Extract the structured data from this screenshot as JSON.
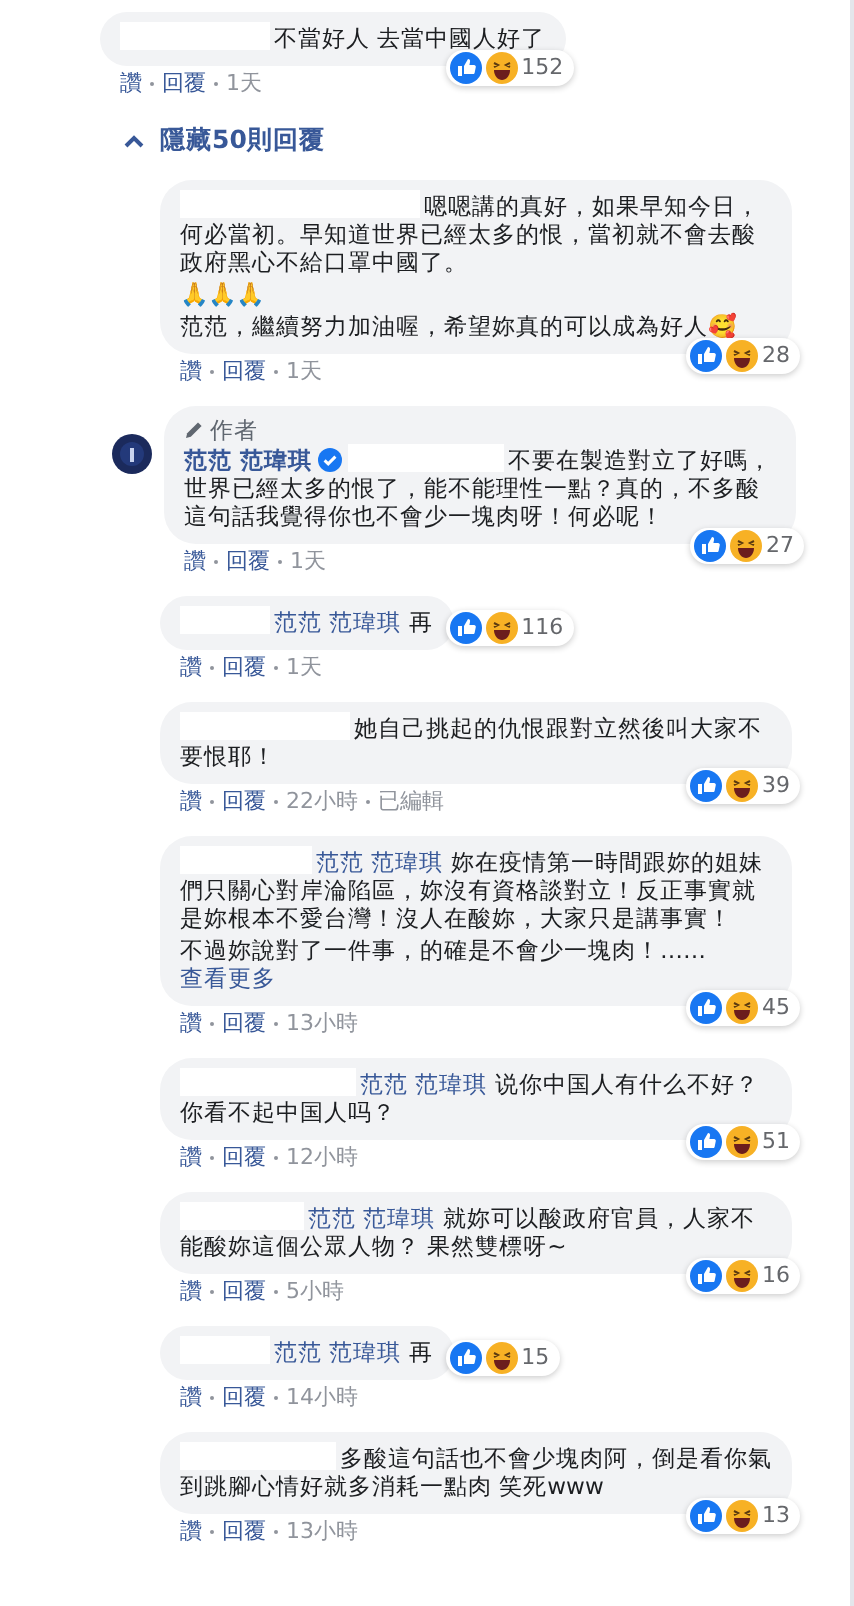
{
  "top_comment": {
    "paragraphs": [
      "不當好人 去當中國人好了"
    ],
    "reaction_count": "152",
    "actions": [
      "讚",
      "回覆",
      "1天"
    ]
  },
  "replies_toggle": {
    "label": "隱藏50則回覆"
  },
  "replies": [
    {
      "paragraphs": [
        "嗯嗯講的真好，如果早知今日，何必當初。早知道世界已經太多的恨，當初就不會去酸政府黑心不給口罩中國了。",
        "🙏🙏🙏",
        "范范，繼續努力加油喔，希望妳真的可以成為好人🥰"
      ],
      "reaction_count": "28",
      "actions": [
        "讚",
        "回覆",
        "1天"
      ]
    },
    {
      "author_badge": "作者",
      "author": "范范 范瑋琪",
      "verified": true,
      "paragraphs": [
        "不要在製造對立了好嗎，世界已經太多的恨了，能不能理性一點？真的，不多酸這句話我覺得你也不會少一塊肉呀！何必呢！"
      ],
      "reaction_count": "27",
      "actions": [
        "讚",
        "回覆",
        "1天"
      ]
    },
    {
      "mention": "范范 范瑋琪",
      "paragraphs": [
        "再"
      ],
      "reaction_count": "116",
      "actions": [
        "讚",
        "回覆",
        "1天"
      ]
    },
    {
      "paragraphs": [
        "她自己挑起的仇恨跟對立然後叫大家不要恨耶！"
      ],
      "reaction_count": "39",
      "actions": [
        "讚",
        "回覆",
        "22小時",
        "已編輯"
      ]
    },
    {
      "mention": "范范 范瑋琪",
      "paragraphs": [
        "妳在疫情第一時間跟妳的姐妹們只關心對岸淪陷區，妳沒有資格談對立！反正事實就是妳根本不愛台灣！沒人在酸妳，大家只是講事實！",
        "不過妳說對了一件事，的確是不會少一塊肉！……"
      ],
      "see_more": "查看更多",
      "reaction_count": "45",
      "actions": [
        "讚",
        "回覆",
        "13小時"
      ]
    },
    {
      "mention": "范范 范瑋琪",
      "paragraphs": [
        "说你中国人有什么不好？你看不起中国人吗？"
      ],
      "reaction_count": "51",
      "actions": [
        "讚",
        "回覆",
        "12小時"
      ]
    },
    {
      "mention": "范范 范瑋琪",
      "paragraphs": [
        "就妳可以酸政府官員，人家不能酸妳這個公眾人物？ 果然雙標呀~"
      ],
      "reaction_count": "16",
      "actions": [
        "讚",
        "回覆",
        "5小時"
      ]
    },
    {
      "mention": "范范 范瑋琪",
      "paragraphs": [
        "再"
      ],
      "reaction_count": "15",
      "actions": [
        "讚",
        "回覆",
        "14小時"
      ]
    },
    {
      "paragraphs": [
        "多酸這句話也不會少塊肉阿，倒是看你氣到跳腳心情好就多消耗一點肉 笑死www"
      ],
      "reaction_count": "13",
      "actions": [
        "讚",
        "回覆",
        "13小時"
      ]
    }
  ]
}
